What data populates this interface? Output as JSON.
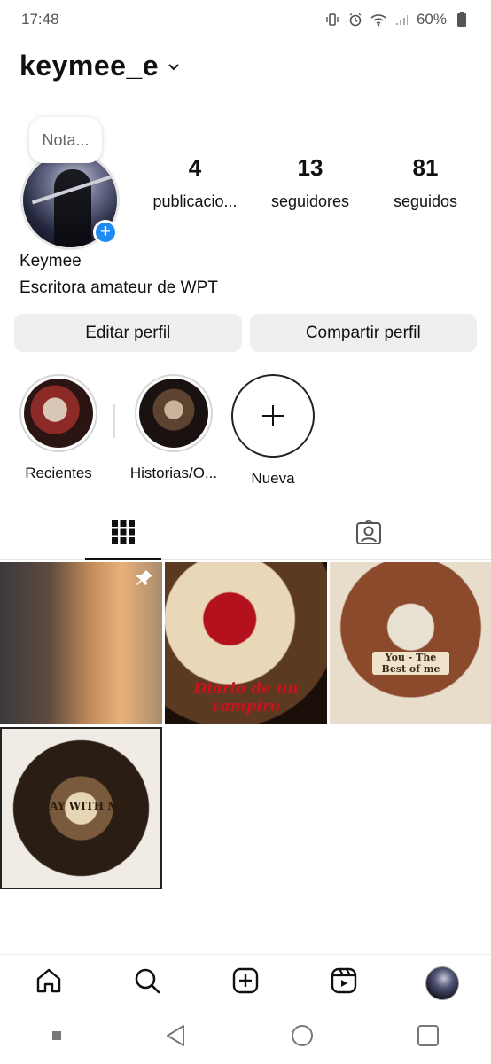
{
  "status": {
    "time": "17:48",
    "battery": "60%"
  },
  "header": {
    "username": "keymee_e"
  },
  "profile": {
    "note": "Nota...",
    "display_name": "Keymee",
    "bio": "Escritora amateur de WPT",
    "stats": [
      {
        "num": "4",
        "label": "publicacio..."
      },
      {
        "num": "13",
        "label": "seguidores"
      },
      {
        "num": "81",
        "label": "seguidos"
      }
    ]
  },
  "actions": {
    "edit": "Editar perfil",
    "share": "Compartir perfil"
  },
  "highlights": [
    {
      "label": "Recientes"
    },
    {
      "label": "Historias/O..."
    },
    {
      "label": "Nueva"
    }
  ],
  "posts": [
    {
      "caption": ""
    },
    {
      "caption": "Diario de un vampiro"
    },
    {
      "caption": "You - The Best of me"
    },
    {
      "caption": "STAY WITH ME"
    }
  ],
  "icons": {
    "status": [
      "vibrate-icon",
      "alarm-icon",
      "wifi-icon",
      "signal-icon",
      "battery-icon"
    ],
    "tabs": [
      "grid-icon",
      "tagged-icon"
    ],
    "nav": [
      "home-icon",
      "search-icon",
      "create-icon",
      "reels-icon",
      "profile-avatar"
    ],
    "system": [
      "recents-icon",
      "back-icon",
      "home-circle-icon",
      "overview-icon"
    ]
  },
  "colors": {
    "accent": "#1d8bf1",
    "button_bg": "#efefef"
  }
}
